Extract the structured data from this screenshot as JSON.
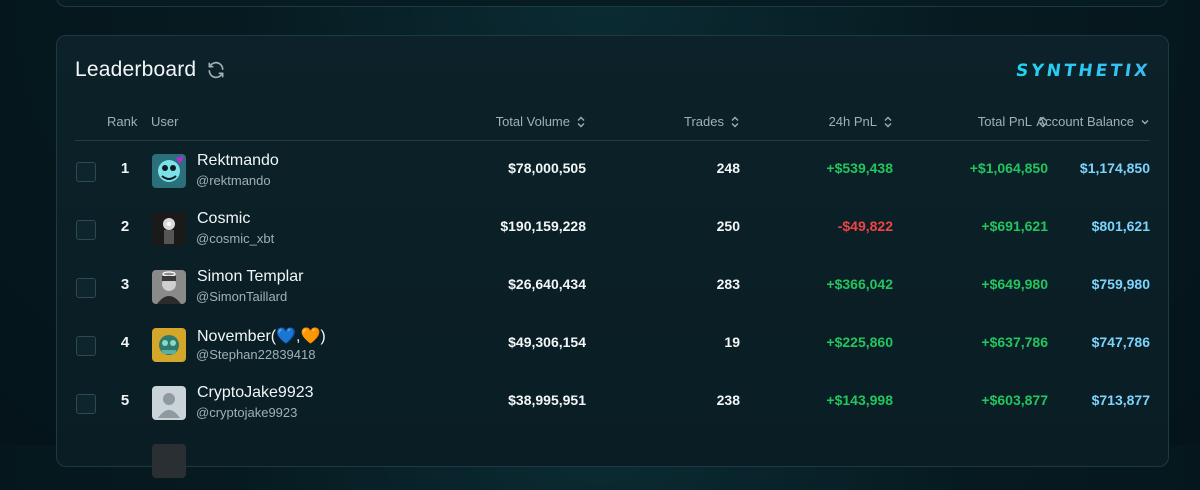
{
  "leaderboard": {
    "title": "Leaderboard",
    "brand": "SYNTHETIX",
    "columns": {
      "rank": "Rank",
      "user": "User",
      "volume": "Total Volume",
      "trades": "Trades",
      "pnl24": "24h PnL",
      "total_pnl": "Total PnL",
      "balance": "Account Balance"
    },
    "rows": [
      {
        "rank": "1",
        "name": "Rektmando",
        "handle": "@rektmando",
        "volume": "$78,000,505",
        "trades": "248",
        "pnl24": "+$539,438",
        "pnl24_sign": "pos",
        "total_pnl": "+$1,064,850",
        "balance": "$1,174,850"
      },
      {
        "rank": "2",
        "name": "Cosmic",
        "handle": "@cosmic_xbt",
        "volume": "$190,159,228",
        "trades": "250",
        "pnl24": "-$49,822",
        "pnl24_sign": "neg",
        "total_pnl": "+$691,621",
        "balance": "$801,621"
      },
      {
        "rank": "3",
        "name": "Simon Templar",
        "handle": "@SimonTaillard",
        "volume": "$26,640,434",
        "trades": "283",
        "pnl24": "+$366,042",
        "pnl24_sign": "pos",
        "total_pnl": "+$649,980",
        "balance": "$759,980"
      },
      {
        "rank": "4",
        "name": "November(💙,🧡)",
        "handle": "@Stephan22839418",
        "volume": "$49,306,154",
        "trades": "19",
        "pnl24": "+$225,860",
        "pnl24_sign": "pos",
        "total_pnl": "+$637,786",
        "balance": "$747,786"
      },
      {
        "rank": "5",
        "name": "CryptoJake9923",
        "handle": "@cryptojake9923",
        "volume": "$38,995,951",
        "trades": "238",
        "pnl24": "+$143,998",
        "pnl24_sign": "pos",
        "total_pnl": "+$603,877",
        "balance": "$713,877"
      }
    ]
  }
}
